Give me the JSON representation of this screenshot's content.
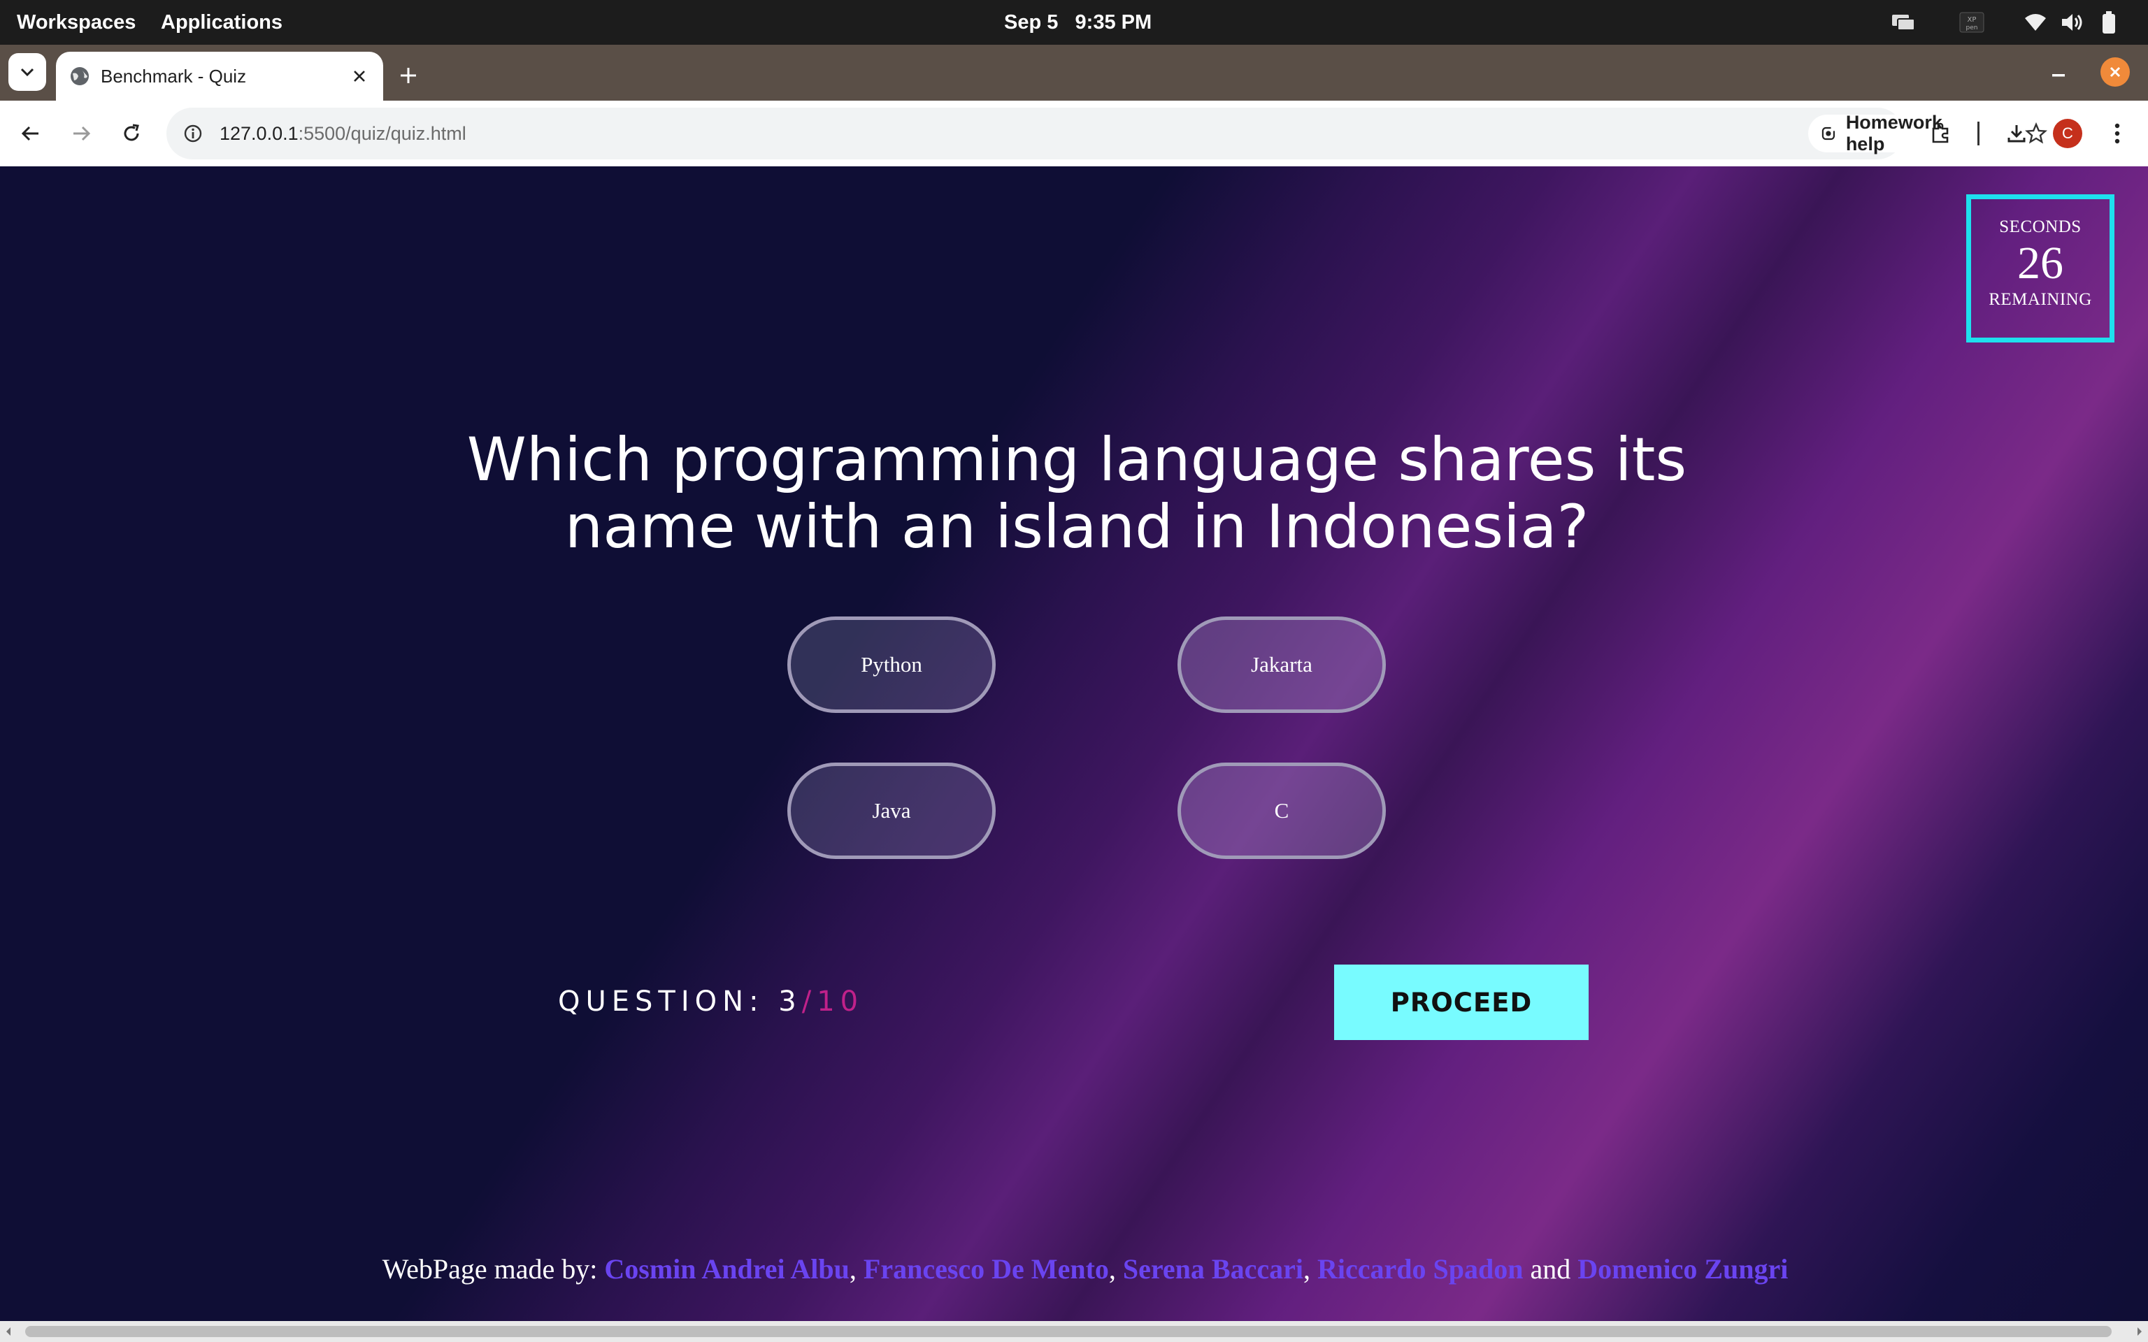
{
  "system_bar": {
    "workspaces_label": "Workspaces",
    "applications_label": "Applications",
    "date": "Sep 5",
    "time": "9:35 PM"
  },
  "browser": {
    "tab_title": "Benchmark - Quiz",
    "url_host": "127.0.0.1",
    "url_rest": ":5500/quiz/quiz.html",
    "homework_help_label": "Homework help",
    "profile_initial": "C"
  },
  "quiz": {
    "timer_top_label": "SECONDS",
    "timer_value": "26",
    "timer_bottom_label": "REMAINING",
    "question": "Which programming language shares its name with an island in Indonesia?",
    "answers": [
      "Python",
      "Jakarta",
      "Java",
      "C"
    ],
    "question_label": "QUESTION: ",
    "question_current": "3",
    "question_total": "/10",
    "proceed_label": "PROCEED"
  },
  "footer": {
    "prefix": "WebPage made by: ",
    "authors": [
      "Cosmin Andrei Albu",
      "Francesco De Mento",
      "Serena Baccari",
      "Riccardo Spadon",
      "Domenico Zungri"
    ],
    "separator": ", ",
    "and_word": " and "
  },
  "colors": {
    "accent_cyan": "#78fbff",
    "timer_border": "#1ee0ee",
    "author_link": "#6a44f0",
    "total_pink": "#c0218a"
  }
}
